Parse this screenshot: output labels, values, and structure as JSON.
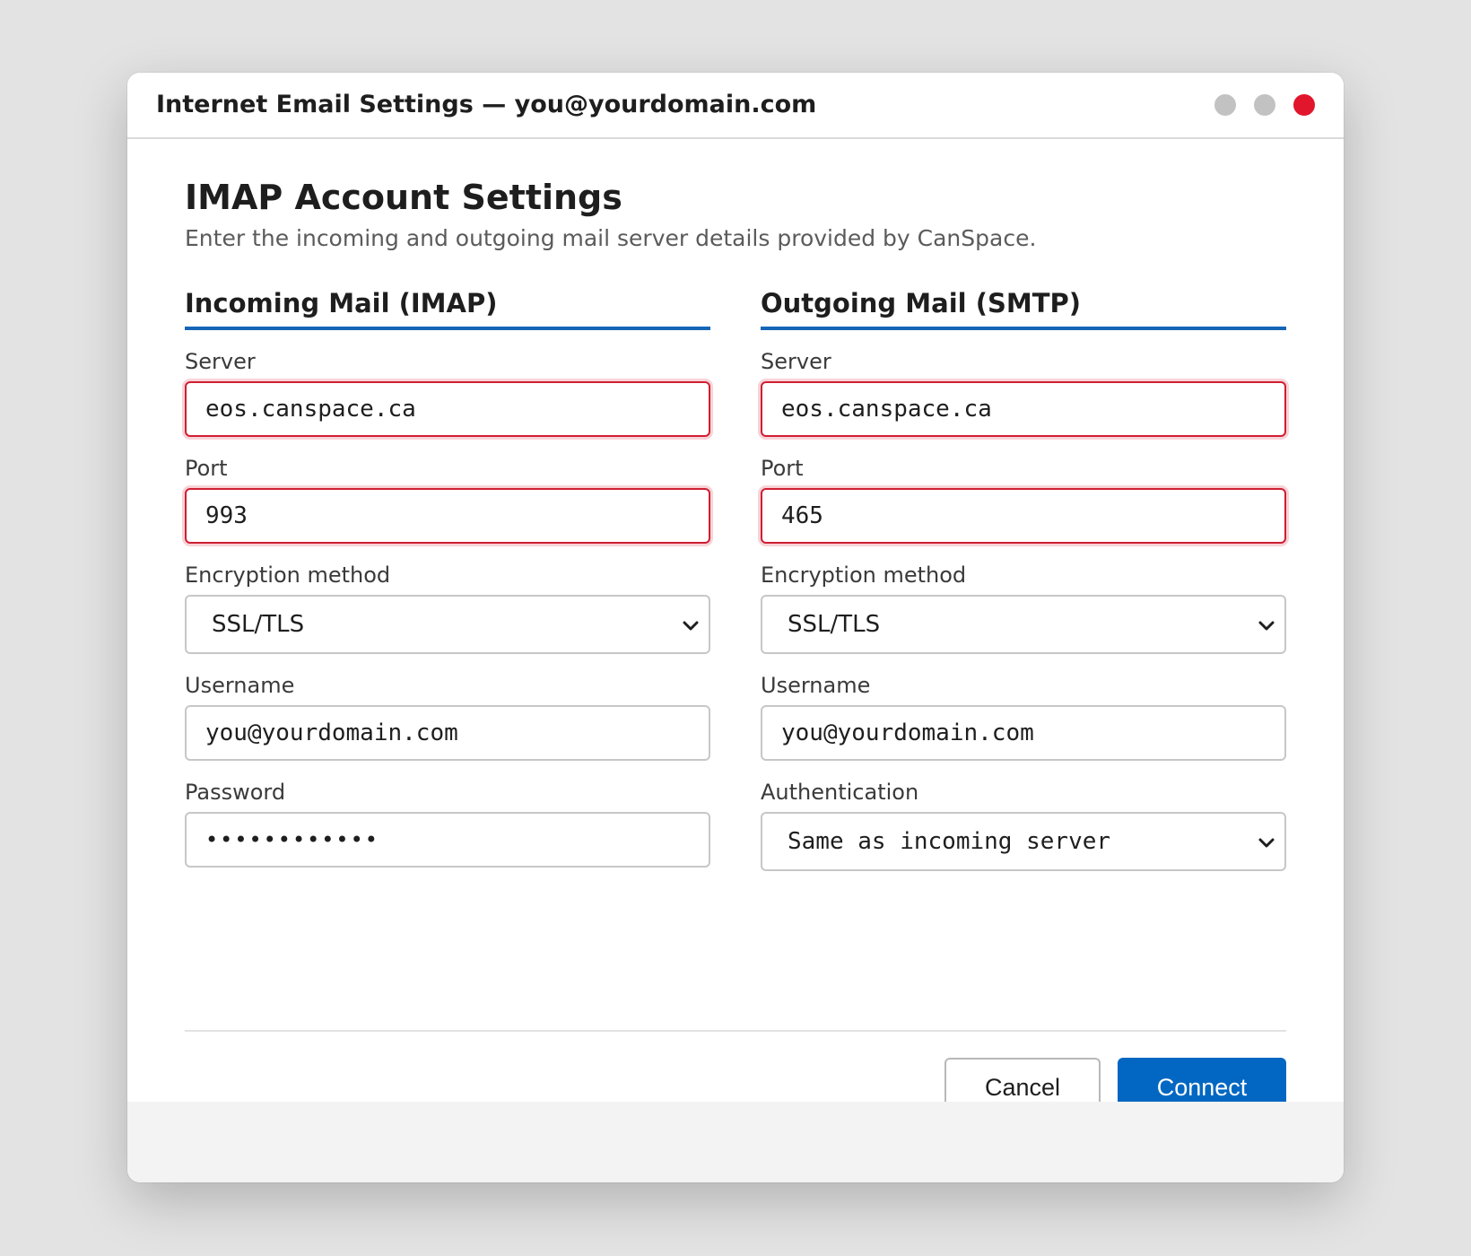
{
  "window": {
    "title": "Internet Email Settings — you@yourdomain.com",
    "controls": [
      "minimize-dot",
      "maximize-dot",
      "close-dot"
    ]
  },
  "heading": {
    "title": "IMAP Account Settings",
    "subtitle": "Enter the incoming and outgoing mail server details provided by CanSpace."
  },
  "incoming": {
    "section_title": "Incoming Mail (IMAP)",
    "server_label": "Server",
    "server_value": "eos.canspace.ca",
    "port_label": "Port",
    "port_value": "993",
    "encryption_label": "Encryption method",
    "encryption_value": "SSL/TLS",
    "username_label": "Username",
    "username_value": "you@yourdomain.com",
    "password_label": "Password",
    "password_value": "••••••••••••"
  },
  "outgoing": {
    "section_title": "Outgoing Mail (SMTP)",
    "server_label": "Server",
    "server_value": "eos.canspace.ca",
    "port_label": "Port",
    "port_value": "465",
    "encryption_label": "Encryption method",
    "encryption_value": "SSL/TLS",
    "username_label": "Username",
    "username_value": "you@yourdomain.com",
    "authentication_label": "Authentication",
    "authentication_value": "Same as incoming server"
  },
  "actions": {
    "cancel_label": "Cancel",
    "connect_label": "Connect"
  },
  "colors": {
    "accent": "#0167c2",
    "error_border": "#cf1f33",
    "close_button": "#e1162c",
    "window_control": "#c2c2c2"
  },
  "icons": {
    "select_arrow": "chevron-down-icon"
  }
}
